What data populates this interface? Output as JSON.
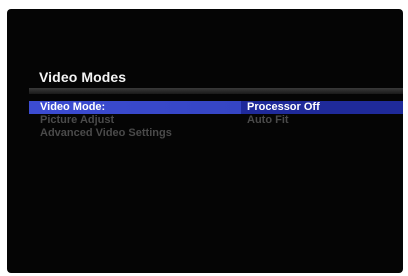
{
  "menu": {
    "title": "Video Modes",
    "items": [
      {
        "label": "Video Mode:",
        "value": "Processor Off",
        "state": "selected"
      },
      {
        "label": "Picture Adjust",
        "value": "Auto Fit",
        "state": "disabled"
      },
      {
        "label": "Advanced Video Settings",
        "value": "",
        "state": "disabled"
      }
    ]
  },
  "colors": {
    "background": "#050505",
    "highlight": "#3a4ad0",
    "highlight_value": "#1f2a9a",
    "text_active": "#ffffff",
    "text_disabled": "#4a4a4a"
  }
}
